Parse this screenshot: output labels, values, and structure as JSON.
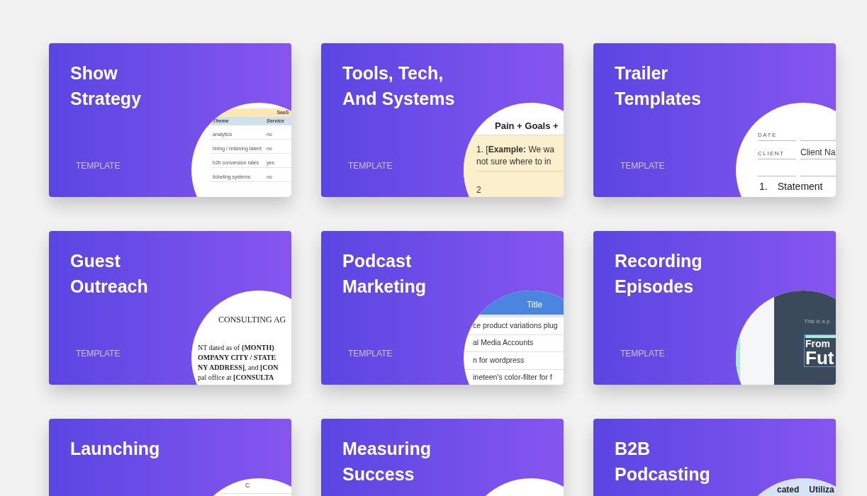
{
  "cards": [
    {
      "title_lines": [
        "Show",
        "Strategy"
      ],
      "badge": "TEMPLATE",
      "preview": {
        "kind": "sheet",
        "band": "SaaS",
        "columns": [
          "Theme",
          "Service"
        ],
        "rows": [
          [
            "analytics",
            "no"
          ],
          [
            "hiring / retaining talent",
            "no"
          ],
          [
            "b2b conversion rates",
            "yes"
          ],
          [
            "ticketing systems",
            "no"
          ]
        ]
      }
    },
    {
      "title_lines": [
        "Tools, Tech,",
        "And Systems"
      ],
      "badge": "TEMPLATE",
      "preview": {
        "kind": "doc",
        "heading": "Pain + Goals +",
        "lines": [
          "1. [**Example:** We wa",
          "not sure where to in"
        ],
        "number": "2"
      }
    },
    {
      "title_lines": [
        "Trailer",
        "Templates"
      ],
      "badge": "TEMPLATE",
      "preview": {
        "kind": "form",
        "fields": [
          {
            "label": "DATE"
          },
          {
            "label": "CLIENT",
            "value": "Client Na"
          }
        ],
        "item_number": "1.",
        "item_text": "Statement"
      }
    },
    {
      "title_lines": [
        "Guest",
        "Outreach"
      ],
      "badge": "TEMPLATE",
      "preview": {
        "kind": "contract",
        "heading": "CONSULTING AG",
        "lines": [
          "NT dated as of **{MONTH}**",
          "**OMPANY CITY / STATE**",
          "**NY ADDRESS]**, and **[CON**",
          "pal office at **[CONSULTA**"
        ]
      }
    },
    {
      "title_lines": [
        "Podcast",
        "Marketing"
      ],
      "badge": "TEMPLATE",
      "preview": {
        "kind": "list",
        "header": "Title",
        "rows": [
          "ce product variations plug",
          "al Media Accounts",
          "n for wordpress",
          "ineteen's color-filter for f"
        ]
      }
    },
    {
      "title_lines": [
        "Recording",
        "Episodes"
      ],
      "badge": "TEMPLATE",
      "preview": {
        "kind": "slide",
        "caption": "This is a p",
        "line1": "From",
        "line2": "Fut"
      }
    },
    {
      "title_lines": [
        "Launching"
      ],
      "preview": {
        "kind": "sheet-top",
        "header": "C"
      }
    },
    {
      "title_lines": [
        "Measuring",
        "Success"
      ],
      "preview": {
        "kind": "blank"
      }
    },
    {
      "title_lines": [
        "B2B",
        "Podcasting"
      ],
      "preview": {
        "kind": "table-top",
        "columns": [
          "cated",
          "Utiliza"
        ]
      }
    }
  ]
}
